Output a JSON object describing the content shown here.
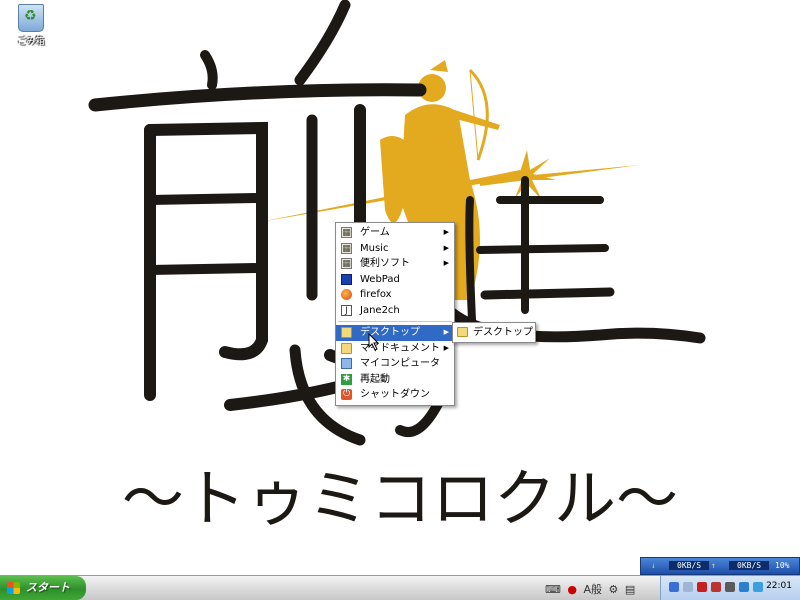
{
  "desktop": {
    "recycle_bin_label": "ごみ箱"
  },
  "wallpaper": {
    "kanji_top": "前",
    "kanji_right": "進",
    "kanji_bottom": "せよ",
    "subtitle": "〜トゥミコロクル〜",
    "ink_color": "#1c1814",
    "figure_color": "#e3a91f"
  },
  "menu": {
    "items": [
      {
        "label": "ゲーム",
        "icon": "app-group-icon",
        "submenu": true
      },
      {
        "label": "Music",
        "icon": "app-group-icon",
        "submenu": true
      },
      {
        "label": "便利ソフト",
        "icon": "app-group-icon",
        "submenu": true
      },
      {
        "label": "WebPad",
        "icon": "webpad-icon",
        "submenu": false
      },
      {
        "label": "firefox",
        "icon": "firefox-icon",
        "submenu": false
      },
      {
        "label": "Jane2ch",
        "icon": "jane2ch-icon",
        "submenu": false
      },
      {
        "label": "デスクトップ",
        "icon": "folder-icon",
        "submenu": true
      },
      {
        "label": "マイドキュメント",
        "icon": "folder-icon",
        "submenu": true
      },
      {
        "label": "マイコンピュータ",
        "icon": "computer-icon",
        "submenu": false
      },
      {
        "label": "再起動",
        "icon": "restart-icon",
        "submenu": false
      },
      {
        "label": "シャットダウン",
        "icon": "shutdown-icon",
        "submenu": false
      }
    ],
    "submenu_label": "デスクトップ",
    "highlight_color": "#316ac5"
  },
  "meter": {
    "down": "0KB/S",
    "up": "0KB/S",
    "percent": "10%"
  },
  "taskbar": {
    "start_label": "スタート",
    "ime_indicator": "A般",
    "clock": "22:01"
  }
}
